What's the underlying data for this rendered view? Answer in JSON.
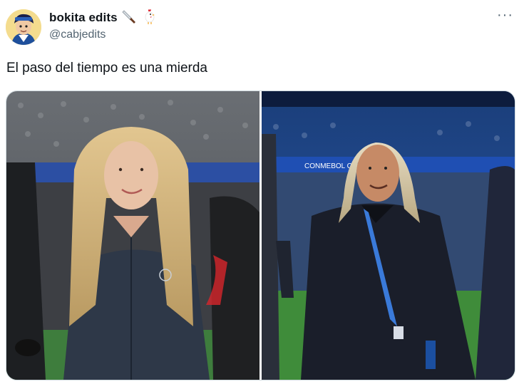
{
  "author": {
    "display_name": "bokita edits",
    "handle": "@cabjedits",
    "emojis": [
      "knife-icon",
      "rooster-icon"
    ]
  },
  "tweet": {
    "text": "El paso del tiempo es una mierda"
  },
  "media": {
    "images": [
      {
        "name": "young-woman-stadium-photo"
      },
      {
        "name": "older-man-stadium-photo",
        "banner_text": "CONMEBOL COPA"
      }
    ]
  },
  "colors": {
    "text_primary": "#0f1419",
    "text_secondary": "#536471",
    "border": "#cfd9de"
  }
}
